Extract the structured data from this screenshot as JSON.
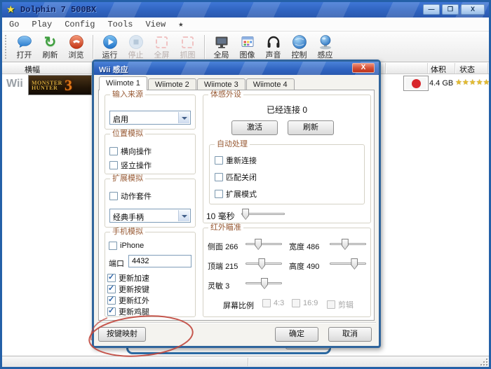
{
  "window": {
    "title": "Dolphin 7 500BX",
    "controls": {
      "minimize": "—",
      "maximize": "❐",
      "close": "X"
    }
  },
  "menu": {
    "items": [
      "Go",
      "Play",
      "Config",
      "Tools",
      "View",
      "★"
    ]
  },
  "toolbar": {
    "buttons": [
      {
        "label": "打开",
        "icon": "speech-bubble-icon",
        "enabled": true
      },
      {
        "label": "刷新",
        "icon": "refresh-icon",
        "enabled": true
      },
      {
        "label": "浏览",
        "icon": "phone-icon",
        "enabled": true
      },
      {
        "label": "运行",
        "icon": "play-icon",
        "enabled": true
      },
      {
        "label": "停止",
        "icon": "stop-icon",
        "enabled": false
      },
      {
        "label": "全屏",
        "icon": "fullscreen-icon",
        "enabled": false
      },
      {
        "label": "抓图",
        "icon": "screenshot-icon",
        "enabled": false
      },
      {
        "label": "全局",
        "icon": "monitor-icon",
        "enabled": true
      },
      {
        "label": "图像",
        "icon": "graphics-icon",
        "enabled": true
      },
      {
        "label": "声音",
        "icon": "headphones-icon",
        "enabled": true
      },
      {
        "label": "控制",
        "icon": "globe-icon",
        "enabled": true
      },
      {
        "label": "感应",
        "icon": "sensor-orb-icon",
        "enabled": true
      }
    ],
    "refresh_glyph": "↻"
  },
  "game_list": {
    "header": {
      "banner": "横幅",
      "size": "体积",
      "status": "状态"
    },
    "row": {
      "platform": "Wii",
      "banner_line1": "MONSTER",
      "banner_line2": "HUNTER",
      "banner_number": "3",
      "size": "4.4 GB",
      "stars": "★★★★★"
    }
  },
  "dialog": {
    "title": "Wii 感应",
    "close_glyph": "X",
    "tabs": [
      "Wiimote 1",
      "Wiimote 2",
      "Wiimote 3",
      "Wiimote 4"
    ],
    "groups": {
      "input_source": {
        "label": "输入来源",
        "dropdown_value": "启用"
      },
      "position": {
        "label": "位置模拟",
        "checkboxes": [
          {
            "label": "横向操作",
            "checked": false
          },
          {
            "label": "竖立操作",
            "checked": false
          }
        ]
      },
      "extension": {
        "label": "扩展模拟",
        "checkboxes": [
          {
            "label": "动作套件",
            "checked": false
          }
        ],
        "dropdown_value": "经典手柄"
      },
      "phone": {
        "label": "手机模拟",
        "iphone": {
          "label": "iPhone",
          "checked": false
        },
        "port_label": "端口",
        "port_value": "4432",
        "update_checkboxes": [
          {
            "label": "更新加速",
            "checked": true
          },
          {
            "label": "更新按键",
            "checked": true
          },
          {
            "label": "更新红外",
            "checked": true
          },
          {
            "label": "更新鸡腿",
            "checked": true
          }
        ]
      },
      "motion": {
        "label": "体感外设",
        "connected_status": "已经连接 0",
        "activate_button": "激活",
        "refresh_button": "刷新",
        "auto": {
          "label": "自动处理",
          "checkboxes": [
            {
              "label": "重新连接",
              "checked": false
            },
            {
              "label": "匹配关闭",
              "checked": false
            },
            {
              "label": "扩展模式",
              "checked": false
            }
          ]
        },
        "delay": {
          "value": "10",
          "unit": "毫秒",
          "percent": 10
        }
      },
      "ir": {
        "label": "红外瞄准",
        "sliders": [
          {
            "label": "侧面",
            "value": "266",
            "percent": 35
          },
          {
            "label": "宽度",
            "value": "486",
            "percent": 42
          },
          {
            "label": "顶端",
            "value": "215",
            "percent": 45
          },
          {
            "label": "高度",
            "value": "490",
            "percent": 68
          },
          {
            "label": "灵敏",
            "value": "3",
            "percent": 52
          }
        ],
        "ratio_label": "屏幕比例",
        "ratio_options": [
          {
            "label": "4:3",
            "checked": false
          },
          {
            "label": "16:9",
            "checked": false
          },
          {
            "label": "剪辑",
            "checked": false
          }
        ]
      }
    },
    "buttons": {
      "mapping": "按键映射",
      "ok": "确定",
      "cancel": "取消"
    }
  },
  "colors": {
    "titlebar_blue": "#2f63c0",
    "window_border": "#2460a8",
    "dialog_border": "#30659c",
    "group_label": "#985a34",
    "annotation_red": "#c0463c",
    "star_gold": "#e3bb2f",
    "flag_red": "#d8262c"
  }
}
